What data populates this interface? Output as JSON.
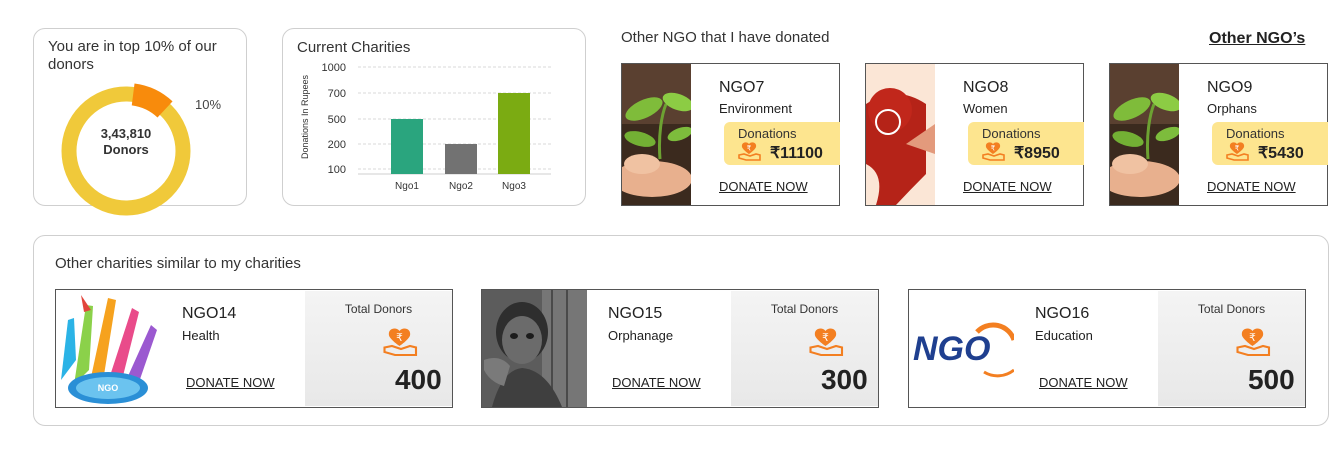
{
  "top_donors": {
    "title": "You are in top 10% of our donors",
    "donor_count": "3,43,810",
    "donor_label": "Donors",
    "percent_label": "10%",
    "percent_value": 10,
    "colors": {
      "ring": "#f0c93a",
      "highlight": "#f88b0c"
    }
  },
  "current_charities": {
    "title": "Current Charities",
    "chart_data": {
      "type": "bar",
      "categories": [
        "Ngo1",
        "Ngo2",
        "Ngo3"
      ],
      "values": [
        500,
        200,
        700
      ],
      "ylabel": "Donations In Rupees",
      "yticks": [
        100,
        200,
        500,
        700,
        1000
      ],
      "colors": [
        "#2aa57e",
        "#727272",
        "#7bab12"
      ]
    }
  },
  "donated": {
    "title": "Other NGO that I have donated",
    "other_link": "Other NGO’s",
    "cards": [
      {
        "name": "NGO7",
        "category": "Environment",
        "donations_label": "Donations",
        "amount": "₹11100",
        "donate_label": "DONATE NOW",
        "photo": "sapling-photo"
      },
      {
        "name": "NGO8",
        "category": "Women",
        "donations_label": "Donations",
        "amount": "₹8950",
        "donate_label": "DONATE NOW",
        "photo": "women-logo"
      },
      {
        "name": "NGO9",
        "category": "Orphans",
        "donations_label": "Donations",
        "amount": "₹5430",
        "donate_label": "DONATE NOW",
        "photo": "sapling-photo"
      }
    ]
  },
  "similar": {
    "title": "Other charities similar to my charities",
    "cards": [
      {
        "name": "NGO14",
        "category": "Health",
        "donate_label": "DONATE NOW",
        "total_label": "Total Donors",
        "total": "400",
        "logo_text": "NGO"
      },
      {
        "name": "NGO15",
        "category": "Orphanage",
        "donate_label": "DONATE NOW",
        "total_label": "Total Donors",
        "total": "300"
      },
      {
        "name": "NGO16",
        "category": "Education",
        "donate_label": "DONATE NOW",
        "total_label": "Total Donors",
        "total": "500",
        "logo_text": "NGO"
      }
    ]
  }
}
